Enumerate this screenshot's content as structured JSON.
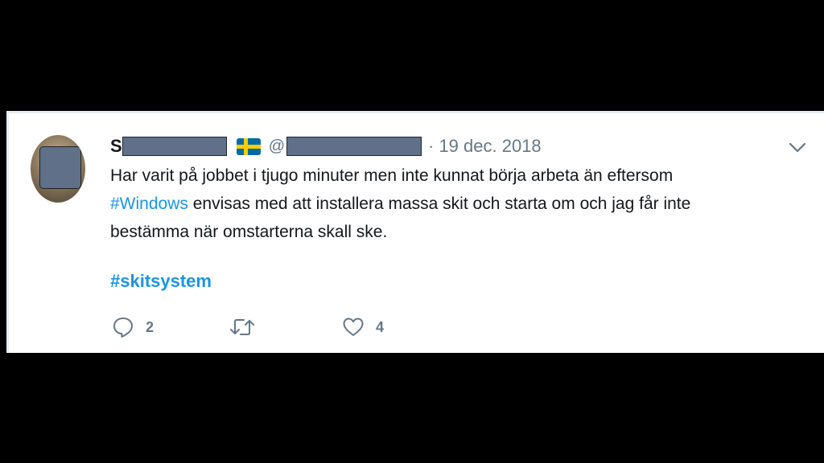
{
  "tweet": {
    "name_initial": "S",
    "at_symbol": "@",
    "date": "· 19 dec. 2018",
    "text_line1": "Har varit på jobbet i tjugo minuter men inte kunnat börja arbeta än eftersom",
    "hashtag_windows": "#Windows",
    "text_line2_rest": " envisas med att installera massa skit och starta om och jag får inte",
    "text_line3": "bestämma när omstarterna skall ske.",
    "hashtag_skitsystem": "#skitsystem"
  },
  "actions": {
    "reply_count": "2",
    "retweet_count": "",
    "like_count": "4"
  },
  "icons": {
    "flag": "sweden-flag-icon",
    "reply": "reply-icon",
    "retweet": "retweet-icon",
    "like": "heart-icon",
    "caret": "chevron-down-icon"
  },
  "colors": {
    "link": "#1b95e0",
    "text": "#14171a",
    "muted": "#657786",
    "redaction": "#607089"
  }
}
